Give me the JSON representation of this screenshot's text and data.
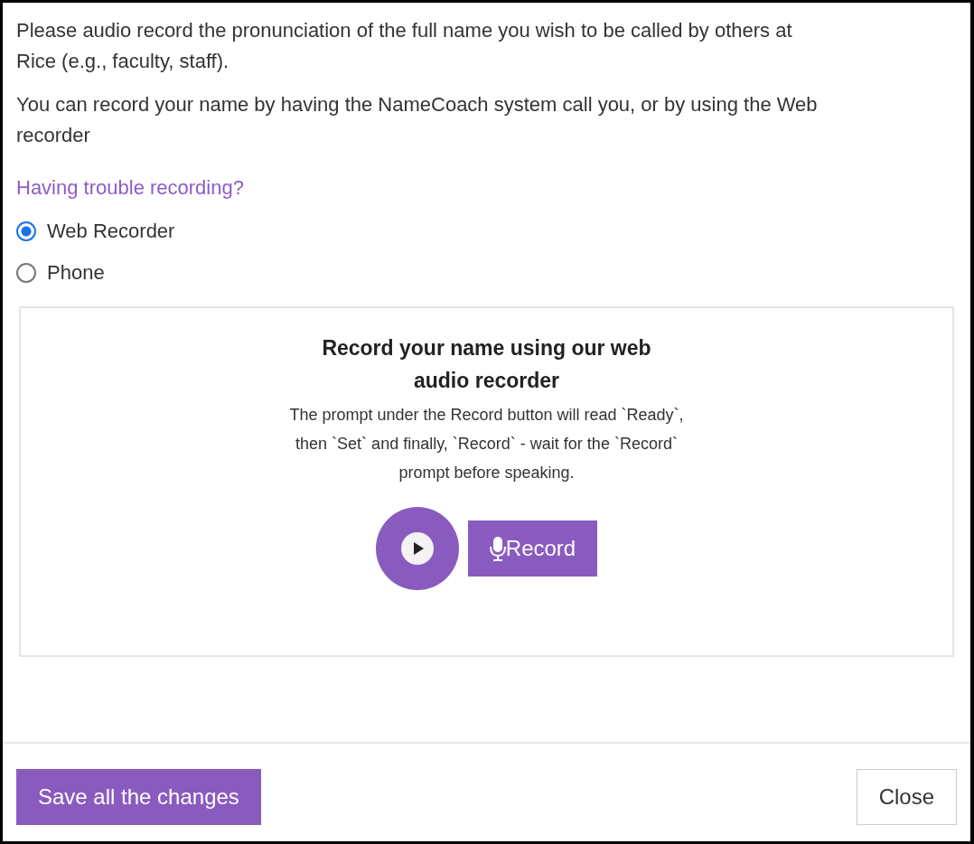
{
  "intro": "Please audio record the pronunciation of the full name you wish to be called by others at Rice (e.g., faculty, staff).",
  "method_text": "You can record your name by having the NameCoach system call you, or by using the Web recorder",
  "help_link": "Having trouble recording?",
  "methods": [
    {
      "label": "Web Recorder",
      "selected": true
    },
    {
      "label": "Phone",
      "selected": false
    }
  ],
  "recorder": {
    "title": "Record your name using our web audio recorder",
    "description": "The prompt under the Record button will read `Ready`, then `Set` and finally, `Record` - wait for the `Record` prompt before speaking.",
    "record_button": "Record"
  },
  "buttons": {
    "save": "Save all the changes",
    "close": "Close"
  }
}
